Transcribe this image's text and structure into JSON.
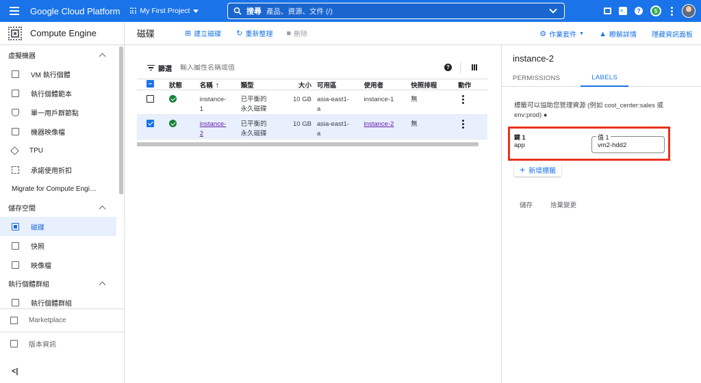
{
  "topbar": {
    "brand": "Google Cloud Platform",
    "project": "My First Project",
    "search_label": "搜尋",
    "search_placeholder": "產品、資源、文件 (/)",
    "notification_count": "5"
  },
  "sidebar": {
    "title": "Compute Engine",
    "sections": [
      {
        "label": "虛擬機器",
        "items": [
          "VM 執行個體",
          "執行個體範本",
          "單一用戶群節點",
          "機器映像檔",
          "TPU",
          "承諾使用折扣",
          "Migrate for Compute Engi…"
        ]
      },
      {
        "label": "儲存空間",
        "items": [
          "磁碟",
          "快照",
          "映像檔"
        ]
      },
      {
        "label": "執行個體群組",
        "items": [
          "執行個體群組"
        ]
      }
    ],
    "active_item": "磁碟",
    "bottom_items": [
      "Marketplace",
      "版本資訊"
    ],
    "collapse_label": "<|"
  },
  "toolbar": {
    "title": "磁碟",
    "create": "建立磁碟",
    "refresh": "重新整理",
    "delete": "刪除",
    "jobs": "作業套件",
    "learn": "瞭解詳情",
    "hide_panel": "隱藏資訊面板"
  },
  "filter": {
    "label": "篩選",
    "placeholder": "輸入屬性名稱或值"
  },
  "table": {
    "headers": [
      "狀態",
      "名稱",
      "類型",
      "大小",
      "可用區",
      "使用者",
      "快照排程",
      "動作"
    ],
    "rows": [
      {
        "name_1": "instance-",
        "name_2": "1",
        "type_1": "已平衡的",
        "type_2": "永久磁碟",
        "size": "10 GB",
        "zone_1": "asia-east1-",
        "zone_2": "a",
        "user": "instance-1",
        "schedule": "無",
        "selected": false
      },
      {
        "name_1": "instance-",
        "name_2": "2",
        "type_1": "已平衡的",
        "type_2": "永久磁碟",
        "size": "10 GB",
        "zone_1": "asia-east1-",
        "zone_2": "a",
        "user": "instance-2",
        "schedule": "無",
        "selected": true
      }
    ]
  },
  "panel": {
    "title": "instance-2",
    "tabs": [
      "PERMISSIONS",
      "LABELS"
    ],
    "active_tab": "LABELS",
    "description_1": "標籤可以協助您管理資源 (例如 cost_center:sales 或",
    "description_2": "env:prod) ●",
    "key_label": "鍵 1",
    "key_value": "app",
    "value_label": "值 1",
    "value_value": "vm2-hdd2",
    "add_label": "新增標籤",
    "save": "儲存",
    "discard": "捨棄變更"
  },
  "colors": {
    "brand_blue": "#1a73e8",
    "highlight_red": "#e8331d",
    "status_green": "#188038",
    "selected_row": "#e8f0fe"
  },
  "icons": [
    "menu-icon",
    "project-icon",
    "search-icon",
    "gift-icon",
    "terminal-icon",
    "help-icon",
    "kebab-icon",
    "compute-chip-icon",
    "filter-icon",
    "columns-icon",
    "check-icon",
    "add-icon"
  ]
}
